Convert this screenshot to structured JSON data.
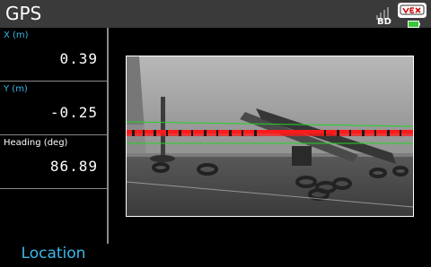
{
  "header": {
    "title": "GPS",
    "radio_label": "BD",
    "signal_icon": "signal-bars-icon",
    "logo_icon": "vex-logo-icon",
    "battery_icon": "battery-icon",
    "colors": {
      "bar": "#3a3a3a",
      "battery": "#39c739"
    }
  },
  "fields": [
    {
      "label": "X (m)",
      "value": "0.39",
      "label_color": "#3ab7e8"
    },
    {
      "label": "Y (m)",
      "value": "-0.25",
      "label_color": "#3ab7e8"
    },
    {
      "label": "Heading (deg)",
      "value": "86.89",
      "label_color": "#ffffff"
    }
  ],
  "location_button": {
    "label": "Location",
    "color": "#3ab7e8"
  },
  "camera": {
    "overlay_colors": {
      "code_strip": "#ff1a1a",
      "guide_lines": "#22d422"
    }
  }
}
